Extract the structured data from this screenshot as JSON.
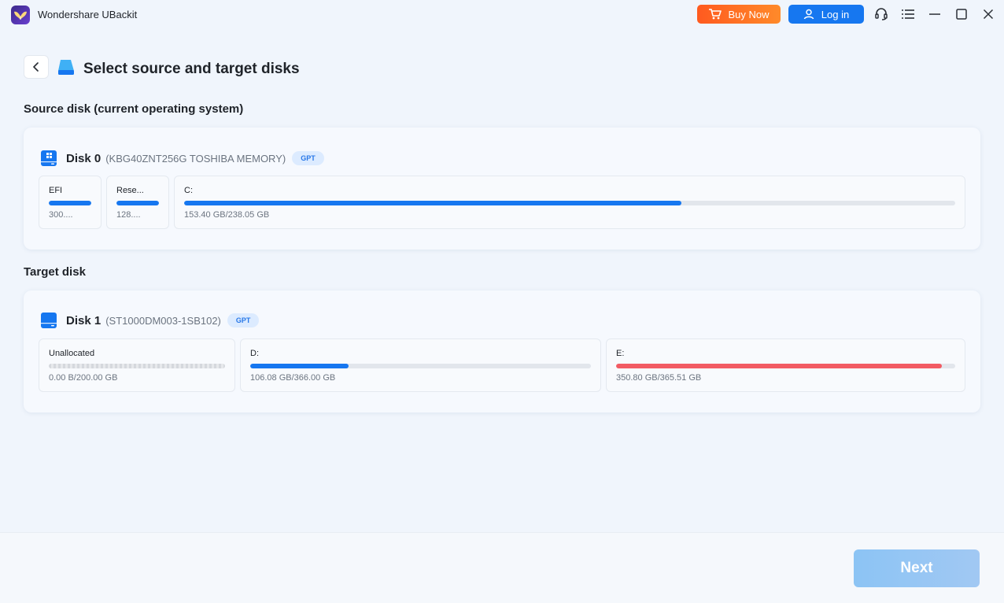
{
  "app": {
    "title": "Wondershare UBackit"
  },
  "titlebar": {
    "buy_now_label": "Buy Now",
    "login_label": "Log in",
    "icons": [
      "cart-icon",
      "user-icon",
      "headset-icon",
      "menu-icon",
      "minimize-icon",
      "maximize-icon",
      "close-icon"
    ]
  },
  "header": {
    "title": "Select source and target disks"
  },
  "source": {
    "section_label": "Source disk (current operating system)",
    "disk": {
      "name": "Disk 0",
      "model": "(KBG40ZNT256G TOSHIBA MEMORY)",
      "badge": "GPT",
      "partitions": [
        {
          "label": "EFI",
          "size": "300....",
          "fill": 1.0,
          "color": "#1677f0"
        },
        {
          "label": "Rese...",
          "size": "128....",
          "fill": 1.0,
          "color": "#1677f0"
        },
        {
          "label": "C:",
          "size": "153.40 GB/238.05 GB",
          "fill": 0.6444,
          "color": "#1677f0"
        }
      ]
    }
  },
  "target": {
    "section_label": "Target disk",
    "disk": {
      "name": "Disk 1",
      "model": "(ST1000DM003-1SB102)",
      "badge": "GPT",
      "partitions": [
        {
          "label": "Unallocated",
          "size": "0.00 B/200.00 GB",
          "fill": 0.0,
          "color": "#d5d8dd"
        },
        {
          "label": "D:",
          "size": "106.08 GB/366.00 GB",
          "fill": 0.2898,
          "color": "#1677f0"
        },
        {
          "label": "E:",
          "size": "350.80 GB/365.51 GB",
          "fill": 0.9598,
          "color": "#f25b63"
        }
      ]
    }
  },
  "footer": {
    "next_label": "Next"
  }
}
